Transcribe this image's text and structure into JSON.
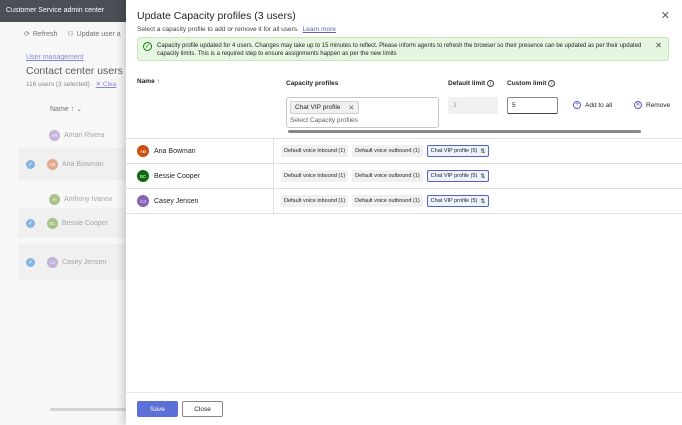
{
  "app": {
    "title": "Customer Service admin center"
  },
  "background": {
    "toolbar": {
      "refresh": "Refresh",
      "update_user": "Update user a"
    },
    "breadcrumb": "User management",
    "heading": "Contact center users",
    "count": "116 users (3 selected)",
    "clear": "Clea",
    "column_name": "Name ↑",
    "rows": [
      {
        "initials": "AR",
        "name": "Amari Rivera",
        "color": "#8764b8",
        "selected": false
      },
      {
        "initials": "AB",
        "name": "Ana Bowman",
        "color": "#ca5010",
        "selected": true
      },
      {
        "initials": "AI",
        "name": "Anthony Ivanov",
        "color": "#498205",
        "selected": false
      },
      {
        "initials": "BC",
        "name": "Bessie Cooper",
        "color": "#498205",
        "selected": true
      },
      {
        "initials": "CJ",
        "name": "Casey Jensen",
        "color": "#8764b8",
        "selected": true
      }
    ]
  },
  "panel": {
    "title": "Update Capacity profiles (3 users)",
    "subtitle": "Select a capacity profile to add or remove it for all users.",
    "learn_more": "Learn more",
    "banner": "Capacity profile updated for 4 users. Changes may take up to 15 minutes to reflect. Please inform agents to refresh the browser so their presence can be updated as per their updated capacity limits. This is a required step to ensure assignments happen as per the new limits",
    "headers": {
      "name": "Name ↑",
      "capacity_profiles": "Capacity profiles",
      "default_limit": "Default limit",
      "custom_limit": "Custom limit"
    },
    "picker": {
      "selected_chip": "Chat VIP profile",
      "placeholder": "Select Capacity profiles"
    },
    "default_limit_value": "3",
    "custom_limit_value": "5",
    "add_to_all": "Add to all",
    "remove": "Remove",
    "users": [
      {
        "initials": "AB",
        "name": "Ana Bowman",
        "color": "#ca5010",
        "profiles": [
          "Default voice inbound (1)",
          "Default voice outbound (1)",
          "Chat VIP profile (5)"
        ]
      },
      {
        "initials": "BC",
        "name": "Bessie Cooper",
        "color": "#0b6a0b",
        "profiles": [
          "Default voice inbound (1)",
          "Default voice outbound (1)",
          "Chat VIP profile (5)"
        ]
      },
      {
        "initials": "CJ",
        "name": "Casey Jensen",
        "color": "#8764b8",
        "profiles": [
          "Default voice inbound (1)",
          "Default voice outbound (1)",
          "Chat VIP profile (5)"
        ]
      }
    ],
    "save": "Save",
    "close": "Close"
  }
}
